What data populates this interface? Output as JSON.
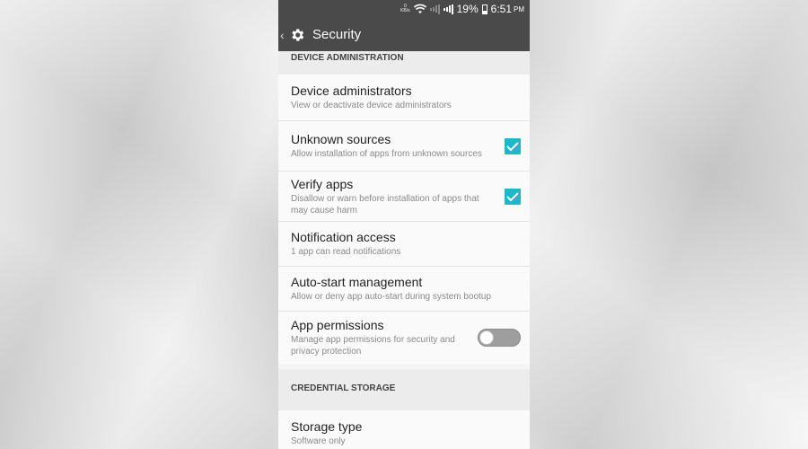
{
  "status_bar": {
    "data_rate_value": "0",
    "data_rate_unit": "KB/s",
    "battery": "19%",
    "time": "6:51",
    "ampm": "PM"
  },
  "action_bar": {
    "title": "Security",
    "back_icon": "chevron-left-icon",
    "app_icon": "gear-icon"
  },
  "sections": {
    "device_admin": {
      "header": "DEVICE ADMINISTRATION",
      "items": [
        {
          "title": "Device administrators",
          "subtitle": "View or deactivate device administrators"
        },
        {
          "title": "Unknown sources",
          "subtitle": "Allow installation of apps from unknown sources",
          "checked": true
        },
        {
          "title": "Verify apps",
          "subtitle": "Disallow or warn before installation of apps that may cause harm",
          "checked": true
        },
        {
          "title": "Notification access",
          "subtitle": "1 app can read notifications"
        },
        {
          "title": "Auto-start management",
          "subtitle": "Allow or deny app auto-start during system bootup"
        },
        {
          "title": "App permissions",
          "subtitle": "Manage app permissions for security and privacy protection",
          "toggle_on": false
        }
      ]
    },
    "credential_storage": {
      "header": "CREDENTIAL STORAGE",
      "items": [
        {
          "title": "Storage type",
          "subtitle": "Software only"
        }
      ]
    }
  },
  "colors": {
    "accent": "#1fb7c9",
    "action_bar": "#4a4a4a"
  }
}
